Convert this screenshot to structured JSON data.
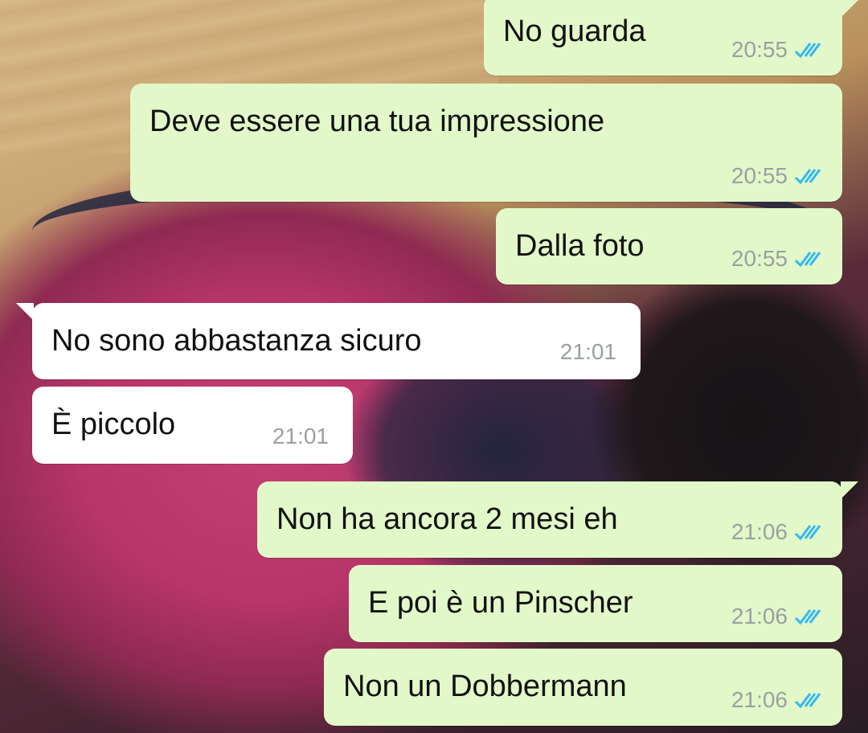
{
  "messages": [
    {
      "text": "No guarda",
      "time": "20:55",
      "direction": "outgoing",
      "read_receipt": "double-check-blue"
    },
    {
      "text": "Deve essere una tua impressione",
      "time": "20:55",
      "direction": "outgoing",
      "read_receipt": "double-check-blue"
    },
    {
      "text": "Dalla foto",
      "time": "20:55",
      "direction": "outgoing",
      "read_receipt": "double-check-blue"
    },
    {
      "text": "No sono abbastanza sicuro",
      "time": "21:01",
      "direction": "incoming"
    },
    {
      "text": "È piccolo",
      "time": "21:01",
      "direction": "incoming"
    },
    {
      "text": "Non ha ancora 2 mesi eh",
      "time": "21:06",
      "direction": "outgoing",
      "read_receipt": "double-check-blue"
    },
    {
      "text": "E poi è un Pinscher",
      "time": "21:06",
      "direction": "outgoing",
      "read_receipt": "double-check-blue"
    },
    {
      "text": "Non un Dobbermann",
      "time": "21:06",
      "direction": "outgoing",
      "read_receipt": "double-check-blue"
    }
  ],
  "colors": {
    "outgoing_bubble": "#e2f8c9",
    "incoming_bubble": "#ffffff",
    "timestamp": "#9aa0a0",
    "read_ticks": "#34b7f1"
  }
}
